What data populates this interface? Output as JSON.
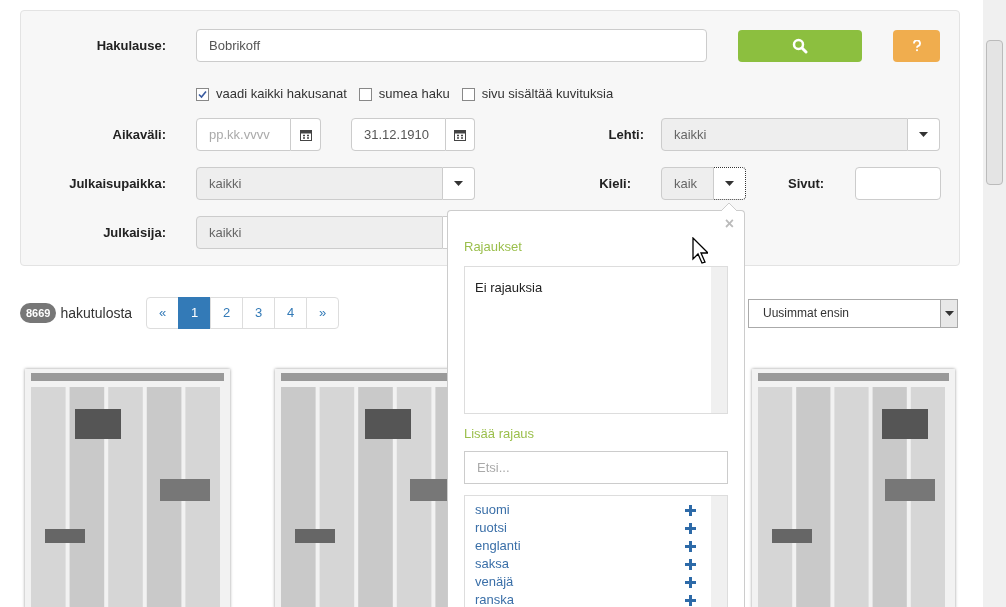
{
  "search": {
    "label": "Hakulause:",
    "value": "Bobrikoff"
  },
  "options": [
    {
      "label": "vaadi kaikki hakusanat",
      "checked": true
    },
    {
      "label": "sumea haku",
      "checked": false
    },
    {
      "label": "sivu sisältää kuvituksia",
      "checked": false
    }
  ],
  "date_range": {
    "label": "Aikaväli:",
    "from_placeholder": "pp.kk.vvvv",
    "to_value": "31.12.1910"
  },
  "newspaper": {
    "label": "Lehti:",
    "value": "kaikki"
  },
  "place": {
    "label": "Julkaisupaikka:",
    "value": "kaikki"
  },
  "language": {
    "label": "Kieli:",
    "value": "kaik",
    "open": true
  },
  "pages": {
    "label": "Sivut:"
  },
  "publisher": {
    "label": "Julkaisija:",
    "value": "kaikki"
  },
  "results": {
    "count": "8669",
    "label": "hakutulosta"
  },
  "pagination": [
    {
      "label": "«",
      "selected": false
    },
    {
      "label": "1",
      "selected": true
    },
    {
      "label": "2",
      "selected": false
    },
    {
      "label": "3",
      "selected": false
    },
    {
      "label": "4",
      "selected": false
    },
    {
      "label": "»",
      "selected": false
    }
  ],
  "sort": {
    "value": "Uusimmat ensin"
  },
  "popover": {
    "close": "×",
    "selected_title": "Rajaukset",
    "selected_empty": "Ei rajauksia",
    "add_title": "Lisää rajaus",
    "search_placeholder": "Etsi...",
    "items": [
      {
        "label": "suomi"
      },
      {
        "label": "ruotsi"
      },
      {
        "label": "englanti"
      },
      {
        "label": "saksa"
      },
      {
        "label": "venäjä"
      },
      {
        "label": "ranska"
      }
    ]
  }
}
